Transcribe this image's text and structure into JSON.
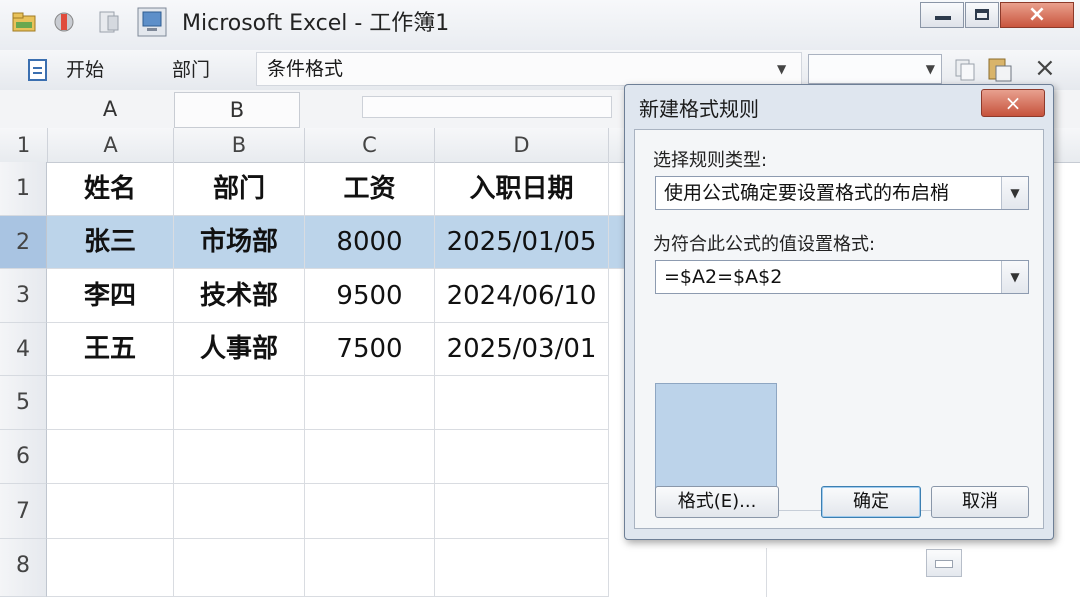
{
  "window": {
    "title": "Microsoft Excel - 工作簿1",
    "minimize_icon": "minimize-icon",
    "maximize_icon": "maximize-icon",
    "close_icon": "close-icon"
  },
  "ribbon": {
    "tab_home": "开始",
    "tab_dept": "部门",
    "cond_format": "条件格式",
    "close_symbol": "×"
  },
  "column_strip": [
    "A",
    "B"
  ],
  "grid": {
    "col_headers": [
      "A",
      "B",
      "C",
      "D"
    ],
    "row_numbers": [
      "1",
      "2",
      "3",
      "4",
      "5",
      "6",
      "7",
      "8"
    ],
    "header_row": [
      "姓名",
      "部门",
      "工资",
      "入职日期"
    ],
    "rows": [
      [
        "张三",
        "市场部",
        "8000",
        "2025/01/05"
      ],
      [
        "李四",
        "技术部",
        "9500",
        "2024/06/10"
      ],
      [
        "王五",
        "人事部",
        "7500",
        "2025/03/01"
      ]
    ],
    "top_left": "1",
    "selection_color": "#bcd4ea"
  },
  "dialog": {
    "title": "新建格式规则",
    "close_symbol": "×",
    "rule_type_label": "选择规则类型:",
    "rule_type_value": "使用公式确定要设置格式的布启梢",
    "formula_label": "为符合此公式的值设置格式:",
    "formula_value": "=$A2=$A$2",
    "preview_color": "#bcd3ea",
    "format_button": "格式(E)...",
    "ok_button": "确定",
    "cancel_button": "取消"
  }
}
